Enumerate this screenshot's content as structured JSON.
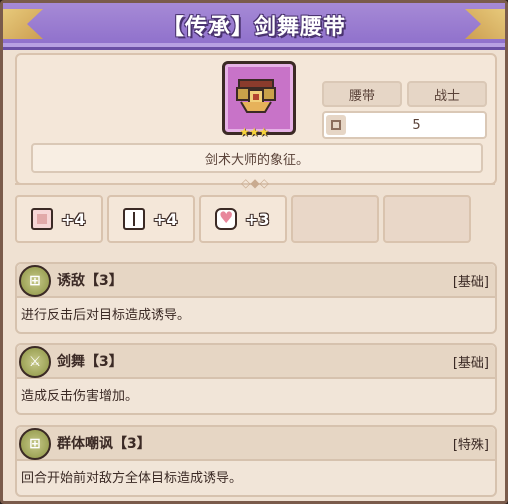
{
  "title": "【传承】剑舞腰带",
  "item": {
    "icon": "belt-icon",
    "rarity_stars": 3,
    "tags": {
      "type": "腰带",
      "class": "战士"
    },
    "slot_value": "5",
    "description": "剑术大师的象征。"
  },
  "stats": [
    {
      "icon": "fist-icon",
      "value": "+4"
    },
    {
      "icon": "book-icon",
      "value": "+4"
    },
    {
      "icon": "heart-icon",
      "value": "+3"
    }
  ],
  "skills": [
    {
      "name": "诱敌【3】",
      "type": "[基础]",
      "desc": "进行反击后对目标造成诱导。",
      "icon_glyph": "⊞"
    },
    {
      "name": "剑舞【3】",
      "type": "[基础]",
      "desc": "造成反击伤害增加。",
      "icon_glyph": "⚔"
    },
    {
      "name": "群体嘲讽【3】",
      "type": "[特殊]",
      "desc": "回合开始前对敌方全体目标造成诱导。",
      "icon_glyph": "⊞"
    }
  ],
  "colors": {
    "banner": "#a68ad6",
    "panel": "#efe1d2",
    "skill_icon": "#9da357"
  }
}
